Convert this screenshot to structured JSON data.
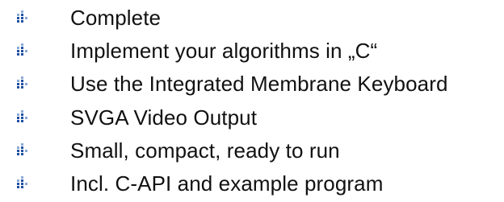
{
  "bullet_icon": "blue-dot-bullet-icon",
  "bullet_colors": {
    "dark": "#1f4fa3",
    "light": "#89a9d6"
  },
  "features": [
    {
      "text": "Complete"
    },
    {
      "text": "Implement your algorithms in „C“"
    },
    {
      "text": "Use the Integrated Membrane Keyboard"
    },
    {
      "text": "SVGA Video Output"
    },
    {
      "text": "Small, compact, ready to run"
    },
    {
      "text": "Incl. C-API and example program"
    }
  ]
}
